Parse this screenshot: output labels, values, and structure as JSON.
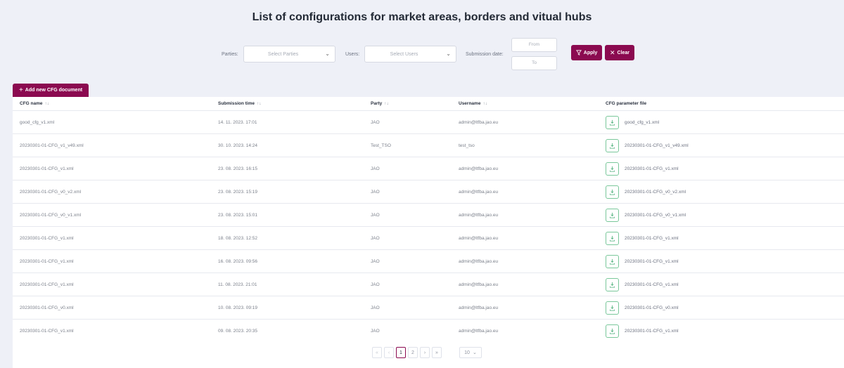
{
  "page": {
    "title": "List of configurations for market areas, borders and vitual hubs"
  },
  "filters": {
    "parties_label": "Parties:",
    "parties_placeholder": "Select Parties",
    "users_label": "Users:",
    "users_placeholder": "Select Users",
    "submission_date_label": "Submission date:",
    "from_placeholder": "From",
    "to_placeholder": "To",
    "apply_label": "Apply",
    "clear_label": "Clear"
  },
  "actions": {
    "add_new_label": "Add new CFG document"
  },
  "table": {
    "headers": {
      "cfg_name": "CFG name",
      "submission_time": "Submission time",
      "party": "Party",
      "username": "Username",
      "cfg_file": "CFG parameter file"
    },
    "sort_glyph": "↑↓",
    "rows": [
      {
        "name": "good_cfg_v1.xml",
        "time": "14. 11. 2023. 17:01",
        "party": "JAO",
        "user": "admin@ltfba.jao.eu",
        "file": "good_cfg_v1.xml"
      },
      {
        "name": "20230301-01-CFG_v1_v49.xml",
        "time": "30. 10. 2023. 14:24",
        "party": "Test_TSO",
        "user": "test_tso",
        "file": "20230301-01-CFG_v1_v49.xml"
      },
      {
        "name": "20230301-01-CFG_v1.xml",
        "time": "23. 08. 2023. 16:15",
        "party": "JAO",
        "user": "admin@ltfba.jao.eu",
        "file": "20230301-01-CFG_v1.xml"
      },
      {
        "name": "20230301-01-CFG_v0_v2.xml",
        "time": "23. 08. 2023. 15:19",
        "party": "JAO",
        "user": "admin@ltfba.jao.eu",
        "file": "20230301-01-CFG_v0_v2.xml"
      },
      {
        "name": "20230301-01-CFG_v0_v1.xml",
        "time": "23. 08. 2023. 15:01",
        "party": "JAO",
        "user": "admin@ltfba.jao.eu",
        "file": "20230301-01-CFG_v0_v1.xml"
      },
      {
        "name": "20230301-01-CFG_v1.xml",
        "time": "18. 08. 2023. 12:52",
        "party": "JAO",
        "user": "admin@ltfba.jao.eu",
        "file": "20230301-01-CFG_v1.xml"
      },
      {
        "name": "20230301-01-CFG_v1.xml",
        "time": "16. 08. 2023. 09:56",
        "party": "JAO",
        "user": "admin@ltfba.jao.eu",
        "file": "20230301-01-CFG_v1.xml"
      },
      {
        "name": "20230301-01-CFG_v1.xml",
        "time": "11. 08. 2023. 21:01",
        "party": "JAO",
        "user": "admin@ltfba.jao.eu",
        "file": "20230301-01-CFG_v1.xml"
      },
      {
        "name": "20230301-01-CFG_v0.xml",
        "time": "10. 08. 2023. 09:19",
        "party": "JAO",
        "user": "admin@ltfba.jao.eu",
        "file": "20230301-01-CFG_v0.xml"
      },
      {
        "name": "20230301-01-CFG_v1.xml",
        "time": "09. 08. 2023. 20:35",
        "party": "JAO",
        "user": "admin@ltfba.jao.eu",
        "file": "20230301-01-CFG_v1.xml"
      }
    ]
  },
  "pagination": {
    "first": "«",
    "prev": "‹",
    "pages": [
      "1",
      "2"
    ],
    "current": "1",
    "next": "›",
    "last": "»",
    "page_size": "10"
  },
  "colors": {
    "accent": "#8b0a50",
    "download_border": "#79c79a",
    "background": "#eef0f7"
  },
  "icons": {
    "filter": "filter-icon",
    "clear": "close-icon",
    "add": "plus-icon",
    "download": "download-icon",
    "chevron": "chevron-down-icon"
  }
}
